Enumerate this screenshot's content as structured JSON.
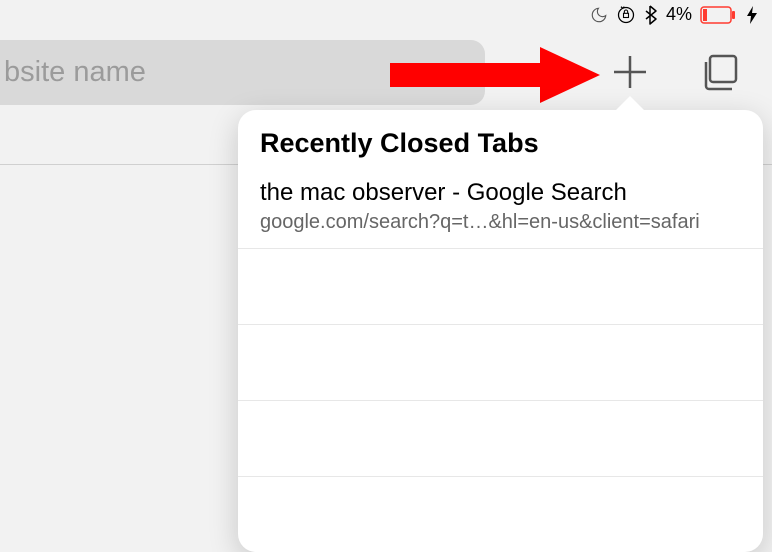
{
  "status": {
    "battery_percent": "4%"
  },
  "toolbar": {
    "address_placeholder": "bsite name"
  },
  "popover": {
    "title": "Recently Closed Tabs",
    "items": [
      {
        "title": "the mac observer - Google Search",
        "url": "google.com/search?q=t…&hl=en-us&client=safari"
      }
    ]
  }
}
